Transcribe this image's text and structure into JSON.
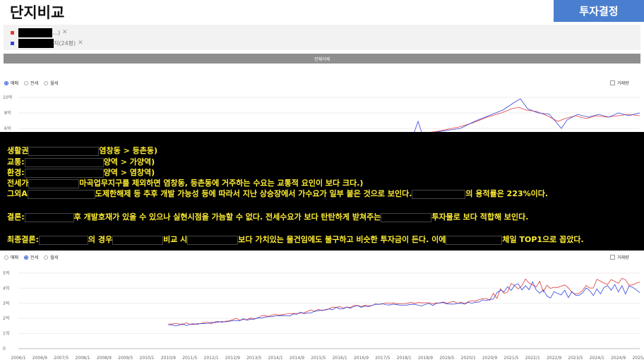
{
  "header": {
    "title": "단지비교",
    "invest_button": "투자결정"
  },
  "compare": {
    "items": [
      {
        "color": "#e03a3a",
        "tail": "…)",
        "remove": "✕"
      },
      {
        "color": "#3344dd",
        "tail": "지(24평)",
        "remove": "✕"
      }
    ],
    "delete_all": "전체삭제"
  },
  "top_chart": {
    "tabs": [
      {
        "label": "매매",
        "selected": true
      },
      {
        "label": "전세",
        "selected": false
      },
      {
        "label": "월세",
        "selected": false
      }
    ],
    "volume_label": "거래량",
    "y_ticks": [
      "10억",
      "8억",
      "6억"
    ]
  },
  "bottom_chart": {
    "tabs": [
      {
        "label": "매매",
        "selected": false
      },
      {
        "label": "전세",
        "selected": true
      },
      {
        "label": "월세",
        "selected": false
      }
    ],
    "volume_label": "거래량",
    "y_ticks": [
      "5억",
      "4억",
      "3억",
      "2억",
      "1억",
      "0"
    ],
    "x_ticks": [
      "2006/1",
      "2006/9",
      "2007/5",
      "2008/1",
      "2008/9",
      "2009/5",
      "2010/1",
      "2010/9",
      "2011/5",
      "2012/1",
      "2012/9",
      "2013/5",
      "2014/1",
      "2014/9",
      "2015/5",
      "2016/1",
      "2016/9",
      "2017/5",
      "2018/1",
      "2018/9",
      "2019/5",
      "2020/1",
      "2020/9",
      "2021/5",
      "2022/1",
      "2022/9",
      "2023/5",
      "2024/1",
      "2024/9",
      "2025/5"
    ]
  },
  "overlay": {
    "line1": {
      "a": "생활권",
      "b": "염창동 > 등촌동)"
    },
    "line2": {
      "a": "교통:",
      "b": "양역 > 가양역)"
    },
    "line3": {
      "a": "환경:",
      "b": "양역 > 염창역)"
    },
    "line4": {
      "a": "전세가",
      "b": "마곡업무지구를 제외하면 염창동, 등촌동에 거주하는 수요는 교통적 요인이 보다 크다.)"
    },
    "line5": {
      "a": "그외A",
      "b": "도제한해제 등 추후 개발 가능성 등에 따라서 지난 상승장에서 가수요가 일부 붙은 것으로 보인다.",
      "c": "의 용적률은 223%이다."
    },
    "line6": {
      "a": "결론:",
      "b": "후 개발호재가 있을 수 있으나 실현시점을 가늠할 수 없다. 전세수요가 보다 탄탄하게 받쳐주는",
      "c": "투자물로 보다 적합해 보인다."
    },
    "line7": {
      "a": "최종결론:",
      "b": "의 경우",
      "c": "비교 시",
      "d": "보다 가치있는 물건임에도 불구하고 비슷한 투자금이 든다. 이에",
      "e": "체일 TOP1으로 꼽았다."
    }
  },
  "chart_data": {
    "type": "line",
    "x_categories": [
      "2006/1",
      "2006/9",
      "2007/5",
      "2008/1",
      "2008/9",
      "2009/5",
      "2010/1",
      "2010/9",
      "2011/5",
      "2012/1",
      "2012/9",
      "2013/5",
      "2014/1",
      "2014/9",
      "2015/5",
      "2016/1",
      "2016/9",
      "2017/5",
      "2018/1",
      "2018/9",
      "2019/5",
      "2020/1",
      "2020/9",
      "2021/5",
      "2022/1",
      "2022/9",
      "2023/5",
      "2024/1",
      "2024/9",
      "2025/5"
    ],
    "ylabel_unit": "억",
    "ylim": [
      0,
      5
    ],
    "series": [
      {
        "color": "#e03a3a",
        "values": [
          null,
          null,
          null,
          null,
          null,
          null,
          null,
          1.6,
          1.65,
          1.7,
          1.9,
          2.05,
          2.2,
          2.35,
          2.55,
          2.75,
          2.85,
          2.95,
          3.0,
          3.0,
          3.05,
          3.05,
          3.35,
          4.2,
          4.3,
          3.9,
          3.9,
          4.4,
          4.6,
          4.4
        ]
      },
      {
        "color": "#3344dd",
        "values": [
          null,
          null,
          null,
          null,
          null,
          null,
          null,
          1.55,
          1.6,
          1.7,
          1.85,
          2.0,
          2.1,
          2.3,
          2.5,
          2.7,
          2.8,
          2.9,
          2.95,
          2.9,
          3.0,
          3.0,
          3.3,
          3.9,
          4.2,
          3.6,
          3.5,
          3.9,
          4.0,
          3.7
        ]
      }
    ],
    "legend": "none",
    "grid": true
  }
}
